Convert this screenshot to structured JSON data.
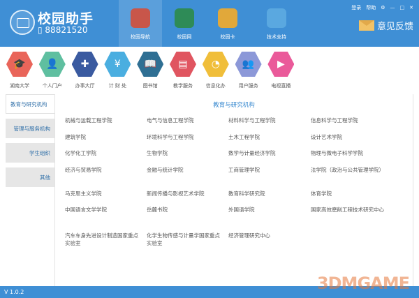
{
  "header": {
    "brand": "校园助手",
    "phone": "88821520",
    "nav": [
      {
        "label": "校园导航",
        "color": "#c8564a"
      },
      {
        "label": "校园网",
        "color": "#2e8b57"
      },
      {
        "label": "校园卡",
        "color": "#e1a83a"
      },
      {
        "label": "技术支持",
        "color": "#5aa8e0"
      }
    ],
    "links": {
      "login": "登录",
      "help": "帮助",
      "settings": "⚙",
      "minimize": "—",
      "maximize": "□",
      "close": "✕"
    },
    "feedback": "意见反馈"
  },
  "quick": [
    {
      "label": "湖南大学",
      "color": "#e9655a",
      "glyph": "🎓"
    },
    {
      "label": "个人门户",
      "color": "#5fbfa0",
      "glyph": "👤"
    },
    {
      "label": "办事大厅",
      "color": "#3a5aa0",
      "glyph": "✚"
    },
    {
      "label": "计 财 处",
      "color": "#4aaee0",
      "glyph": "¥"
    },
    {
      "label": "图书馆",
      "color": "#2f6f93",
      "glyph": "📖"
    },
    {
      "label": "教学服务",
      "color": "#e05560",
      "glyph": "▤"
    },
    {
      "label": "信息化办",
      "color": "#f0be3a",
      "glyph": "◔"
    },
    {
      "label": "用户服务",
      "color": "#8c98d8",
      "glyph": "👥"
    },
    {
      "label": "电视直播",
      "color": "#ea5a9a",
      "glyph": "▶"
    }
  ],
  "tabs": [
    "教育与研究机构",
    "管理与服务机构",
    "学生组织",
    "其他"
  ],
  "panel": {
    "title": "教育与研究机构",
    "rows": [
      [
        "机械与运载工程学院",
        "电气与信息工程学院",
        "材料科学与工程学院",
        "信息科学与工程学院"
      ],
      [
        "建筑学院",
        "环境科学与工程学院",
        "土木工程学院",
        "设计艺术学院"
      ],
      [
        "化学化工学院",
        "生物学院",
        "数学与计量经济学院",
        "物理与微电子科学学院"
      ],
      [
        "经济与贸易学院",
        "金融与统计学院",
        "工商管理学院",
        "法学院（政治与公共管理学院）"
      ],
      [
        "马克思主义学院",
        "新闻传播与影视艺术学院",
        "教育科学研究院",
        "体育学院"
      ],
      [
        "中国语言文学学院",
        "岳麓书院",
        "外国语学院",
        "国家高效磨削工程技术研究中心"
      ],
      [
        "汽车车身先进设计制造国家重点实验室",
        "化学生物传感与计量学国家重点实验室",
        "经济管理研究中心"
      ]
    ]
  },
  "footer": {
    "version": "V 1.0.2"
  },
  "watermark": "3DMGAME"
}
